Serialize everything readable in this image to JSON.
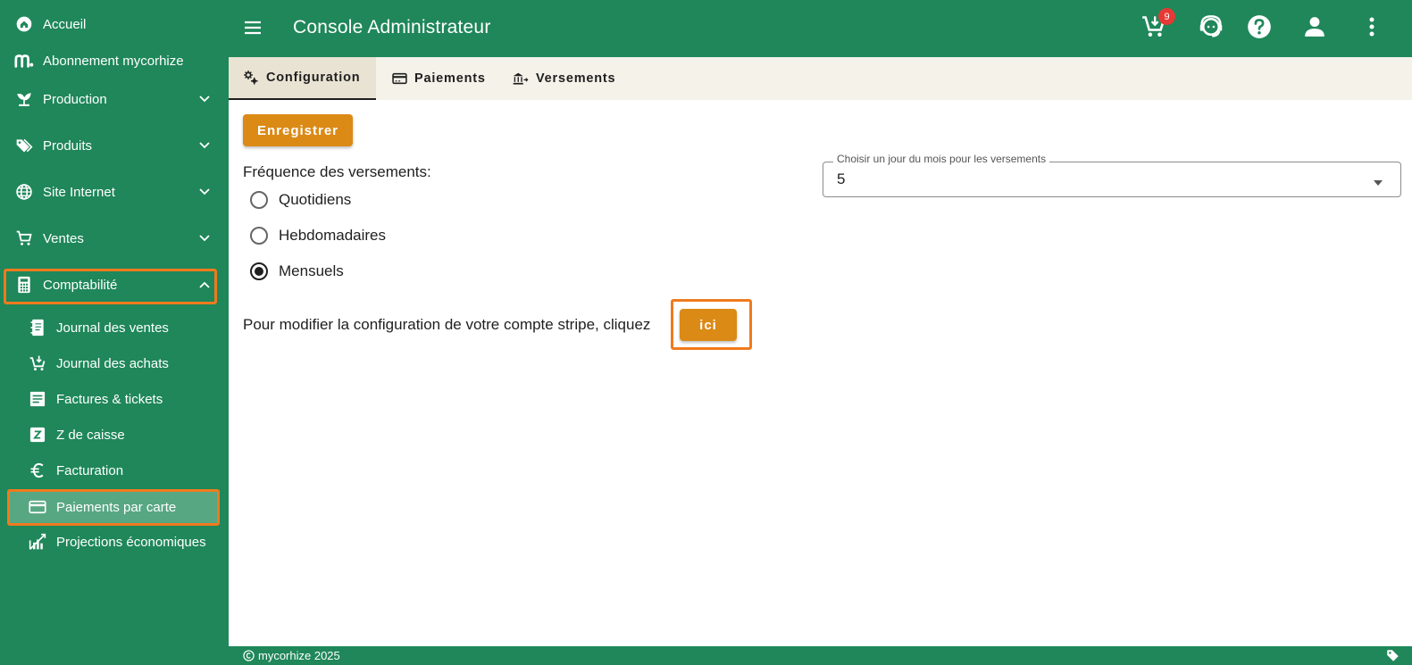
{
  "app": {
    "title": "Console Administrateur",
    "brand_color": "#1f875a",
    "accent_color": "#db8a16",
    "highlight_color": "#f07a1d"
  },
  "sidebar": {
    "items": [
      {
        "label": "Accueil",
        "icon": "home-icon"
      },
      {
        "label": "Abonnement mycorhize",
        "icon": "mycorhize-logo-icon"
      },
      {
        "label": "Production",
        "icon": "sprout-icon",
        "expandable": true
      },
      {
        "label": "Produits",
        "icon": "tags-icon",
        "expandable": true
      },
      {
        "label": "Site Internet",
        "icon": "globe-icon",
        "expandable": true
      },
      {
        "label": "Ventes",
        "icon": "cart-icon",
        "expandable": true
      },
      {
        "label": "Comptabilité",
        "icon": "calculator-icon",
        "expandable": true,
        "expanded": true
      }
    ],
    "subitems": [
      {
        "label": "Journal des ventes",
        "icon": "journal-icon"
      },
      {
        "label": "Journal des achats",
        "icon": "cart-arrow-icon"
      },
      {
        "label": "Factures & tickets",
        "icon": "receipt-icon"
      },
      {
        "label": "Z de caisse",
        "icon": "z-box-icon"
      },
      {
        "label": "Facturation",
        "icon": "euro-icon"
      },
      {
        "label": "Paiements par carte",
        "icon": "credit-card-icon",
        "active": true
      },
      {
        "label": "Projections économiques",
        "icon": "chart-projection-icon"
      }
    ]
  },
  "topbar": {
    "cart_badge": "9",
    "icons": [
      "menu-icon",
      "cart-download-icon",
      "support-agent-icon",
      "help-icon",
      "account-icon",
      "more-vert-icon"
    ]
  },
  "tabs": [
    {
      "label": "Configuration",
      "icon": "cogs-icon",
      "active": true
    },
    {
      "label": "Paiements",
      "icon": "credit-card-icon"
    },
    {
      "label": "Versements",
      "icon": "bank-transfer-icon"
    }
  ],
  "content": {
    "save_label": "Enregistrer",
    "frequency_label": "Fréquence des versements:",
    "frequency_options": [
      "Quotidiens",
      "Hebdomadaires",
      "Mensuels"
    ],
    "frequency_selected": "Mensuels",
    "day_select": {
      "label": "Choisir un jour du mois pour les versements",
      "value": "5"
    },
    "stripe_text": "Pour modifier la configuration de votre compte stripe, cliquez",
    "stripe_button": "ici"
  },
  "footer": {
    "text": "mycorhize 2025"
  }
}
